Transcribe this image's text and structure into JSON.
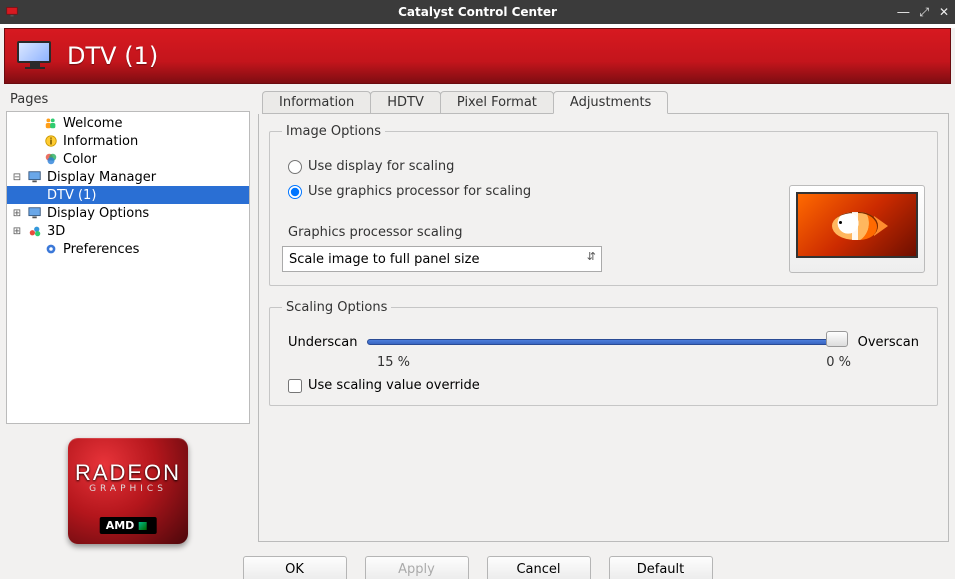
{
  "window": {
    "title": "Catalyst Control Center"
  },
  "banner": {
    "title": "DTV (1)"
  },
  "sidebar": {
    "header": "Pages",
    "items": [
      {
        "label": "Welcome",
        "icon": "people"
      },
      {
        "label": "Information",
        "icon": "info"
      },
      {
        "label": "Color",
        "icon": "color"
      },
      {
        "label": "Display Manager",
        "icon": "monitor",
        "expander": "⊟"
      },
      {
        "label": "DTV (1)",
        "icon": "",
        "selected": true
      },
      {
        "label": "Display Options",
        "icon": "monitor",
        "expander": "⊞"
      },
      {
        "label": "3D",
        "icon": "3d",
        "expander": "⊞"
      },
      {
        "label": "Preferences",
        "icon": "gear"
      }
    ]
  },
  "logo": {
    "line1": "RADEON",
    "line2": "GRAPHICS",
    "badge": "AMD"
  },
  "tabs": [
    {
      "label": "Information"
    },
    {
      "label": "HDTV"
    },
    {
      "label": "Pixel Format"
    },
    {
      "label": "Adjustments",
      "active": true
    }
  ],
  "image_options": {
    "legend": "Image Options",
    "radio1_label": "Use display for scaling",
    "radio2_label": "Use graphics processor for scaling",
    "selected": "gpu",
    "gp_label": "Graphics processor scaling",
    "select_value": "Scale image to full panel size"
  },
  "scaling_options": {
    "legend": "Scaling Options",
    "left_label": "Underscan",
    "right_label": "Overscan",
    "tick_left": "15 %",
    "tick_right": "0 %",
    "checkbox_label": "Use scaling value override",
    "checkbox_checked": false,
    "slider_value_pct_from_left": 100
  },
  "footer": {
    "ok": "OK",
    "apply": "Apply",
    "cancel": "Cancel",
    "default": "Default"
  }
}
